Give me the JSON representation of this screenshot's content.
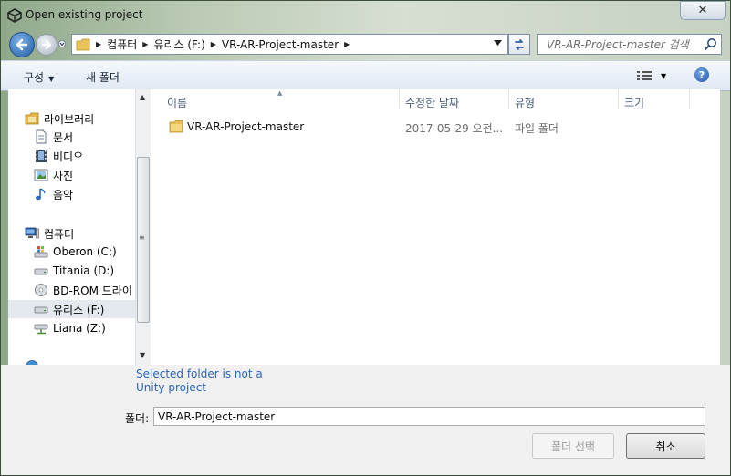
{
  "window": {
    "title": "Open existing project",
    "close_label": "✕"
  },
  "address": {
    "crumbs": [
      "컴퓨터",
      "유리스 (F:)",
      "VR-AR-Project-master"
    ]
  },
  "search": {
    "placeholder": "VR-AR-Project-master 검색"
  },
  "toolbar": {
    "organize_label": "구성",
    "new_folder_label": "새 폴더",
    "help_label": "?"
  },
  "nav": {
    "items": [
      {
        "label": "라이브러리",
        "icon": "library-icon"
      },
      {
        "label": "문서",
        "icon": "document-icon"
      },
      {
        "label": "비디오",
        "icon": "video-icon"
      },
      {
        "label": "사진",
        "icon": "picture-icon"
      },
      {
        "label": "음악",
        "icon": "music-icon"
      },
      {
        "label": "컴퓨터",
        "icon": "computer-icon"
      },
      {
        "label": "Oberon (C:)",
        "icon": "system-drive-icon"
      },
      {
        "label": "Titania (D:)",
        "icon": "drive-icon"
      },
      {
        "label": "BD-ROM 드라이",
        "icon": "disc-drive-icon"
      },
      {
        "label": "유리스 (F:)",
        "icon": "drive-icon",
        "selected": true
      },
      {
        "label": "Liana (Z:)",
        "icon": "network-drive-icon"
      }
    ]
  },
  "columns": {
    "name": "이름",
    "modified": "수정한 날짜",
    "type": "유형",
    "size": "크기"
  },
  "files": [
    {
      "name": "VR-AR-Project-master",
      "modified": "2017-05-29 오전...",
      "type": "파일 폴더"
    }
  ],
  "status": {
    "line1": "Selected folder is not a",
    "line2": "Unity project"
  },
  "folder_field": {
    "label": "폴더:",
    "value": "VR-AR-Project-master"
  },
  "buttons": {
    "select_folder": "폴더 선택",
    "cancel": "취소"
  }
}
